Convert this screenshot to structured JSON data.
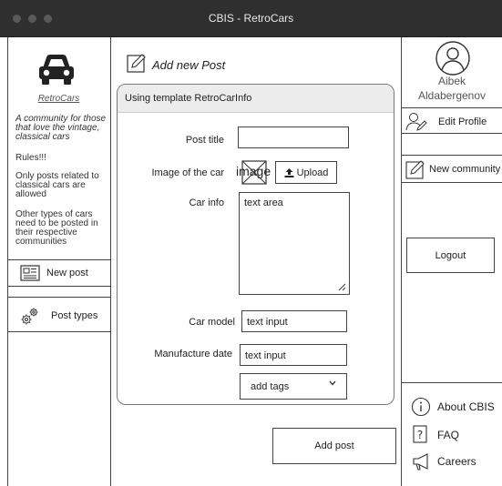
{
  "window": {
    "title": "CBIS - RetroCars"
  },
  "sidebar": {
    "brand": "RetroCars",
    "tagline": "A community for those that love the vintage, classical cars",
    "rules_title": "Rules!!!",
    "rule_1": "Only posts related to classical cars are allowed",
    "rule_2": "Other types of cars need to be posted in their respective communities",
    "nav": {
      "new_post": "New post",
      "post_types": "Post types"
    }
  },
  "main": {
    "heading": "Add new Post",
    "template_label": "Using template RetroCarInfo",
    "form": {
      "post_title_label": "Post title",
      "post_title_value": "",
      "image_label": "Image of the car",
      "image_placeholder": "image",
      "upload_label": "Upload",
      "car_info_label": "Car info",
      "car_info_value": "text area",
      "car_model_label": "Car model",
      "car_model_value": "text input",
      "manufacture_date_label": "Manufacture date",
      "manufacture_date_value": "text input",
      "tags_value": "add tags"
    },
    "submit_label": "Add post"
  },
  "right": {
    "user_first_name": "Aibek",
    "user_last_name": "Aldabergenov",
    "edit_profile": "Edit Profile",
    "new_community": "New community",
    "logout": "Logout",
    "footer": {
      "about": "About CBIS",
      "faq": "FAQ",
      "careers": "Careers"
    }
  },
  "colors": {
    "titlebar": "#2f2f2f",
    "panel_header": "#ececec"
  }
}
